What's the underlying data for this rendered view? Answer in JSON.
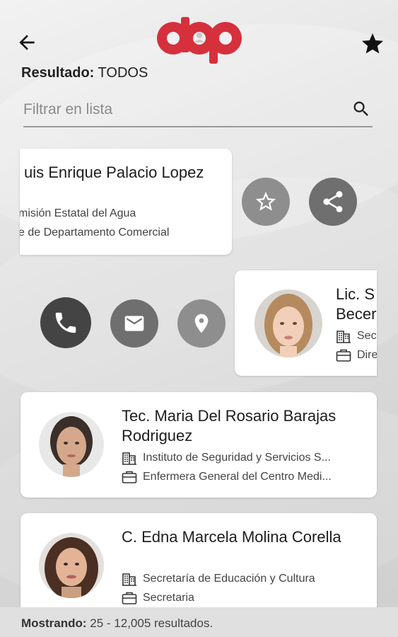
{
  "header": {
    "back_icon": "arrow-left-icon",
    "favorite_icon": "star-icon",
    "logo_text": "dap",
    "brand_color": "#d6303d"
  },
  "result": {
    "label": "Resultado:",
    "value": "TODOS"
  },
  "filter": {
    "placeholder": "Filtrar en lista",
    "value": ""
  },
  "contacts": [
    {
      "name": "uis Enrique Palacio Lopez",
      "institution": "misión Estatal del Agua",
      "position": "e de Departamento Comercial",
      "actions": [
        "favorite",
        "share"
      ]
    },
    {
      "name_line1": "Lic. S",
      "name_line2": "Becer",
      "institution": "Sec",
      "position": "Dire",
      "actions": [
        "call",
        "email",
        "location"
      ]
    },
    {
      "name_line1": "Tec. Maria Del Rosario Barajas",
      "name_line2": "Rodriguez",
      "institution": "Instituto de Seguridad y Servicios S...",
      "position": "Enfermera General del Centro Medi..."
    },
    {
      "name": "C. Edna Marcela Molina Corella",
      "institution": "Secretaría de Educación y Cultura",
      "position": "Secretaria"
    }
  ],
  "footer": {
    "label": "Mostrando:",
    "value": "25 - 12,005 resultados."
  }
}
